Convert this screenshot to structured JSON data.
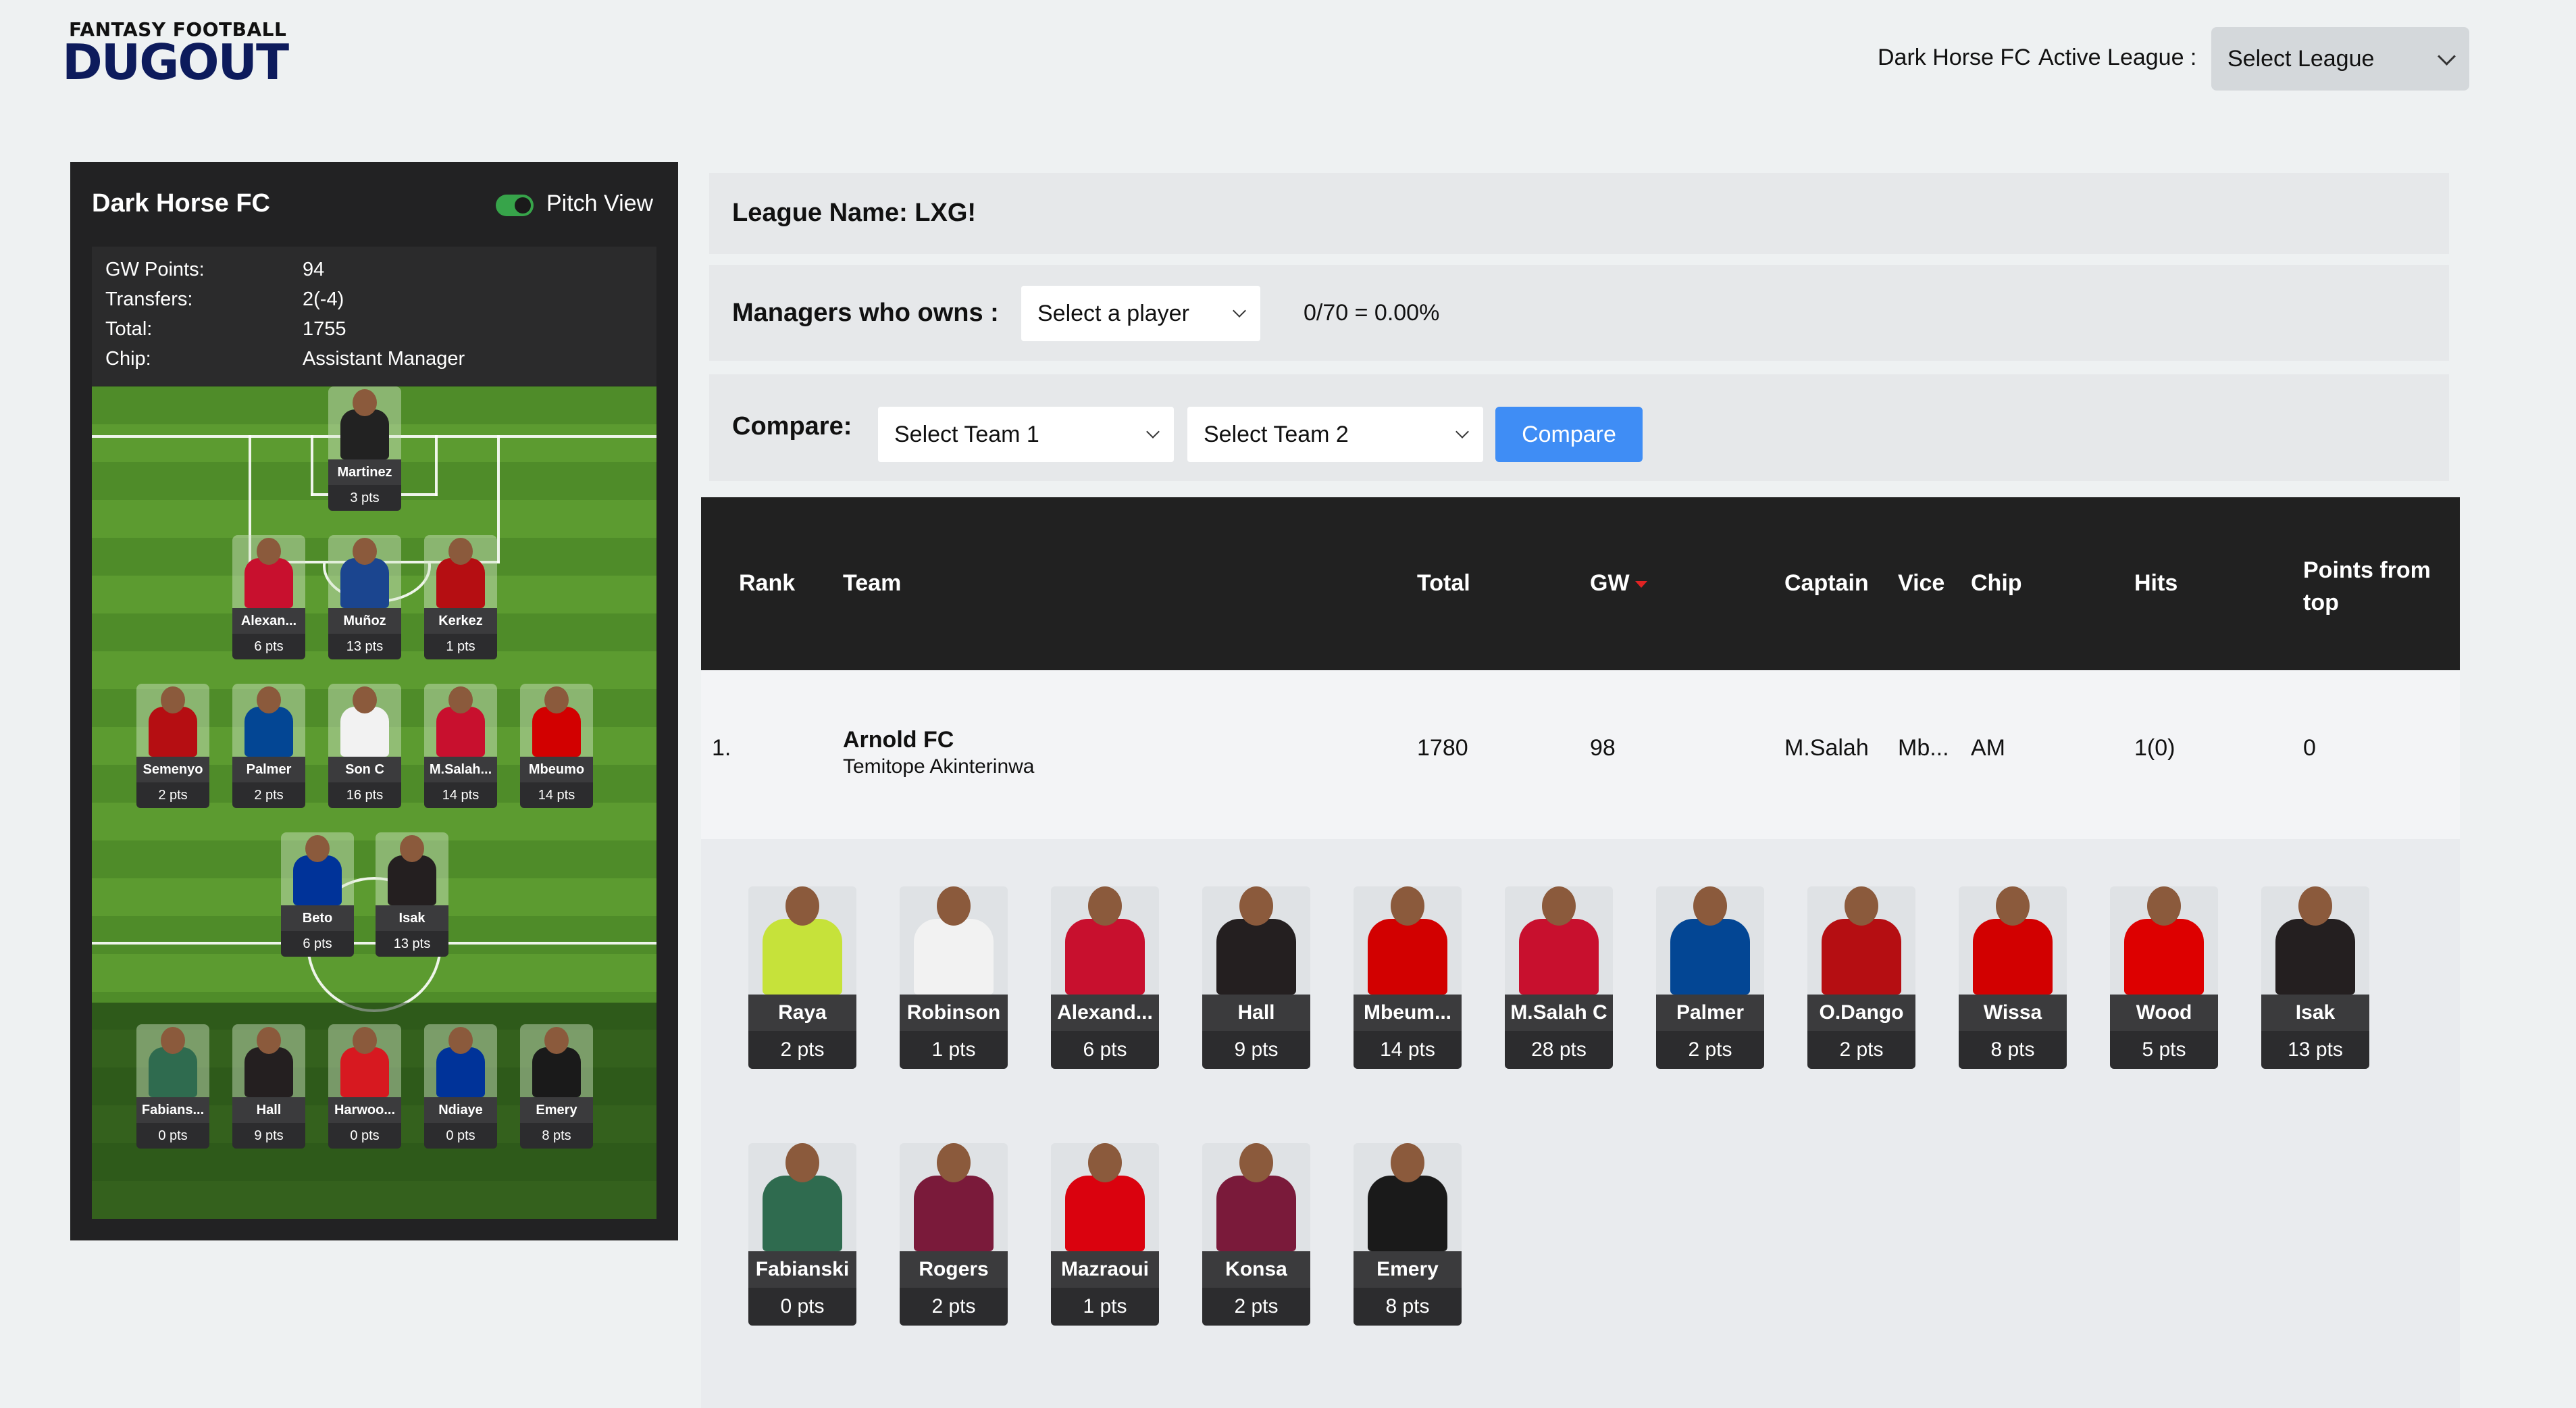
{
  "header": {
    "logo_top": "FANTASY FOOTBALL",
    "logo_main": "DUGOUT",
    "team_name": "Dark Horse FC",
    "active_league_label": "Active League :",
    "league_select": "Select League"
  },
  "panel": {
    "title": "Dark Horse FC",
    "toggle_label": "Pitch View",
    "stats": [
      {
        "k": "GW Points:",
        "v": "94"
      },
      {
        "k": "Transfers:",
        "v": "2(-4)"
      },
      {
        "k": "Total:",
        "v": "1755"
      },
      {
        "k": "Chip:",
        "v": "Assistant Manager"
      }
    ],
    "pitch_players": [
      {
        "name": "Martinez",
        "pts": "3 pts",
        "color": "#222222"
      },
      {
        "name": "Alexan...",
        "pts": "6 pts",
        "color": "#c8102e"
      },
      {
        "name": "Muñoz",
        "pts": "13 pts",
        "color": "#1b458f"
      },
      {
        "name": "Kerkez",
        "pts": "1 pts",
        "color": "#b50e12"
      },
      {
        "name": "Semenyo",
        "pts": "2 pts",
        "color": "#b50e12"
      },
      {
        "name": "Palmer",
        "pts": "2 pts",
        "color": "#034694"
      },
      {
        "name": "Son C",
        "pts": "16 pts",
        "color": "#f2f2f2"
      },
      {
        "name": "M.Salah...",
        "pts": "14 pts",
        "color": "#c8102e"
      },
      {
        "name": "Mbeumo",
        "pts": "14 pts",
        "color": "#d20000"
      },
      {
        "name": "Beto",
        "pts": "6 pts",
        "color": "#003399"
      },
      {
        "name": "Isak",
        "pts": "13 pts",
        "color": "#241f20"
      }
    ],
    "bench_players": [
      {
        "name": "Fabians...",
        "pts": "0 pts",
        "color": "#2f6b4f"
      },
      {
        "name": "Hall",
        "pts": "9 pts",
        "color": "#241f20"
      },
      {
        "name": "Harwoo...",
        "pts": "0 pts",
        "color": "#d71920"
      },
      {
        "name": "Ndiaye",
        "pts": "0 pts",
        "color": "#003399"
      },
      {
        "name": "Emery",
        "pts": "8 pts",
        "color": "#1a1a1a"
      }
    ]
  },
  "league": {
    "name_label": "League Name: LXG!",
    "owners_label": "Managers who owns :",
    "player_select": "Select a player",
    "owners_ratio": "0/70 = 0.00%",
    "compare_label": "Compare:",
    "team1_select": "Select Team 1",
    "team2_select": "Select Team 2",
    "compare_button": "Compare"
  },
  "table": {
    "headers": {
      "rank": "Rank",
      "team": "Team",
      "total": "Total",
      "gw": "GW",
      "captain": "Captain",
      "vice": "Vice",
      "chip": "Chip",
      "hits": "Hits",
      "points_from_top_1": "Points from",
      "points_from_top_2": "top"
    },
    "rows": [
      {
        "rank": "1.",
        "team_name": "Arnold FC",
        "manager": "Temitope Akinterinwa",
        "total": "1780",
        "gw": "98",
        "captain": "M.Salah",
        "vice": "Mb...",
        "chip": "AM",
        "hits": "1(0)",
        "points_from_top": "0"
      }
    ]
  },
  "squad": {
    "row1": [
      {
        "name": "Raya",
        "pts": "2 pts",
        "color": "#c6e23a"
      },
      {
        "name": "Robinson",
        "pts": "1 pts",
        "color": "#f2f2f2"
      },
      {
        "name": "Alexand...",
        "pts": "6 pts",
        "color": "#c8102e"
      },
      {
        "name": "Hall",
        "pts": "9 pts",
        "color": "#241f20"
      },
      {
        "name": "Mbeum...",
        "pts": "14 pts",
        "color": "#d20000"
      },
      {
        "name": "M.Salah C",
        "pts": "28 pts",
        "color": "#c8102e"
      },
      {
        "name": "Palmer",
        "pts": "2 pts",
        "color": "#034694"
      },
      {
        "name": "O.Dango",
        "pts": "2 pts",
        "color": "#b50e12"
      },
      {
        "name": "Wissa",
        "pts": "8 pts",
        "color": "#d20000"
      },
      {
        "name": "Wood",
        "pts": "5 pts",
        "color": "#dd0000"
      },
      {
        "name": "Isak",
        "pts": "13 pts",
        "color": "#241f20"
      }
    ],
    "row2": [
      {
        "name": "Fabianski",
        "pts": "0 pts",
        "color": "#2f6b4f"
      },
      {
        "name": "Rogers",
        "pts": "2 pts",
        "color": "#7a1a3a"
      },
      {
        "name": "Mazraoui",
        "pts": "1 pts",
        "color": "#da020e"
      },
      {
        "name": "Konsa",
        "pts": "2 pts",
        "color": "#7a1a3a"
      },
      {
        "name": "Emery",
        "pts": "8 pts",
        "color": "#1a1a1a"
      }
    ]
  }
}
